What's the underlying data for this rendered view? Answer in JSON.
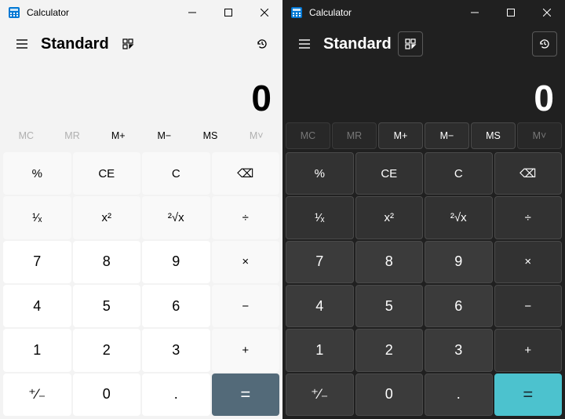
{
  "themes": [
    "light",
    "dark"
  ],
  "colors": {
    "light_eq": "#536a79",
    "dark_eq": "#4cc2ce"
  },
  "title": "Calculator",
  "mode": "Standard",
  "display": "0",
  "memory": [
    {
      "label": "MC",
      "enabled": false
    },
    {
      "label": "MR",
      "enabled": false
    },
    {
      "label": "M+",
      "enabled": true
    },
    {
      "label": "M−",
      "enabled": true
    },
    {
      "label": "MS",
      "enabled": true
    },
    {
      "label": "M˅",
      "enabled": false
    }
  ],
  "keys": [
    [
      {
        "l": "%",
        "t": "fn",
        "n": "percent"
      },
      {
        "l": "CE",
        "t": "fn",
        "n": "clear-entry"
      },
      {
        "l": "C",
        "t": "fn",
        "n": "clear"
      },
      {
        "l": "⌫",
        "t": "fn",
        "n": "backspace"
      }
    ],
    [
      {
        "l": "¹⁄ₓ",
        "t": "fn",
        "n": "reciprocal"
      },
      {
        "l": "x²",
        "t": "fn",
        "n": "square"
      },
      {
        "l": "²√x",
        "t": "fn",
        "n": "sqrt"
      },
      {
        "l": "÷",
        "t": "fn",
        "n": "divide"
      }
    ],
    [
      {
        "l": "7",
        "t": "num",
        "n": "digit-7"
      },
      {
        "l": "8",
        "t": "num",
        "n": "digit-8"
      },
      {
        "l": "9",
        "t": "num",
        "n": "digit-9"
      },
      {
        "l": "×",
        "t": "fn",
        "n": "multiply"
      }
    ],
    [
      {
        "l": "4",
        "t": "num",
        "n": "digit-4"
      },
      {
        "l": "5",
        "t": "num",
        "n": "digit-5"
      },
      {
        "l": "6",
        "t": "num",
        "n": "digit-6"
      },
      {
        "l": "−",
        "t": "fn",
        "n": "subtract"
      }
    ],
    [
      {
        "l": "1",
        "t": "num",
        "n": "digit-1"
      },
      {
        "l": "2",
        "t": "num",
        "n": "digit-2"
      },
      {
        "l": "3",
        "t": "num",
        "n": "digit-3"
      },
      {
        "l": "+",
        "t": "fn",
        "n": "add"
      }
    ],
    [
      {
        "l": "⁺∕₋",
        "t": "num",
        "n": "negate"
      },
      {
        "l": "0",
        "t": "num",
        "n": "digit-0"
      },
      {
        "l": ".",
        "t": "num",
        "n": "decimal"
      },
      {
        "l": "=",
        "t": "eq",
        "n": "equals"
      }
    ]
  ]
}
